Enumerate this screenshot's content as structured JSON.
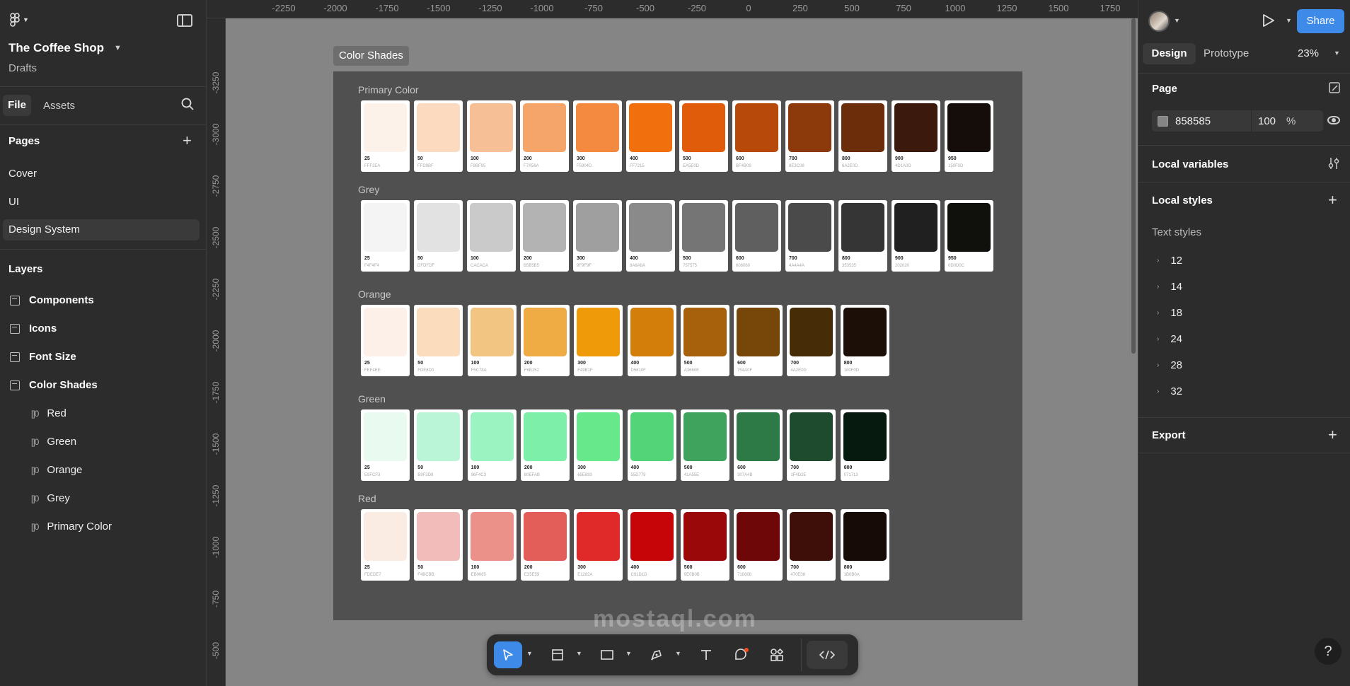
{
  "project": {
    "title": "The Coffee Shop",
    "location": "Drafts"
  },
  "left": {
    "tabs": {
      "file": "File",
      "assets": "Assets"
    },
    "pages_heading": "Pages",
    "pages": [
      "Cover",
      "UI",
      "Design System"
    ],
    "layers_heading": "Layers",
    "layers": [
      "Components",
      "Icons",
      "Font Size",
      "Color Shades"
    ],
    "sublayers": [
      "Red",
      "Green",
      "Orange",
      "Grey",
      "Primary Color"
    ]
  },
  "ruler_top": [
    "-2250",
    "-2000",
    "-1750",
    "-1500",
    "-1250",
    "-1000",
    "-750",
    "-500",
    "-250",
    "0",
    "250",
    "500",
    "750",
    "1000",
    "1250",
    "1500",
    "1750"
  ],
  "ruler_left": [
    "-3250",
    "-3000",
    "-2750",
    "-2500",
    "-2250",
    "-2000",
    "-1750",
    "-1500",
    "-1250",
    "-1000",
    "-750",
    "-500"
  ],
  "canvas": {
    "frame_label": "Color Shades",
    "groups": [
      {
        "title": "Primary Color",
        "cards": [
          {
            "name": "25",
            "hex": "FFF2EA",
            "color": "#fcf2ea"
          },
          {
            "name": "50",
            "hex": "FFD9BF",
            "color": "#fbdabf"
          },
          {
            "name": "100",
            "hex": "F9BF95",
            "color": "#f7bf95"
          },
          {
            "name": "200",
            "hex": "F7A56A",
            "color": "#f5a46a"
          },
          {
            "name": "300",
            "hex": "F5904D",
            "color": "#f38a40"
          },
          {
            "name": "400",
            "hex": "FF7215",
            "color": "#f26f0d"
          },
          {
            "name": "500",
            "hex": "EA5E0D",
            "color": "#e05b0a"
          },
          {
            "name": "600",
            "hex": "BF4B09",
            "color": "#b74a0a"
          },
          {
            "name": "700",
            "hex": "8E3C08",
            "color": "#8c3a0b"
          },
          {
            "name": "800",
            "hex": "6A2E0D",
            "color": "#6b2d0a"
          },
          {
            "name": "900",
            "hex": "4D1A0D",
            "color": "#3b1a0d"
          },
          {
            "name": "950",
            "hex": "150F0D",
            "color": "#150d0a"
          }
        ]
      },
      {
        "title": "Grey",
        "cards": [
          {
            "name": "25",
            "hex": "F4F4F4",
            "color": "#f4f4f4"
          },
          {
            "name": "50",
            "hex": "DFDFDF",
            "color": "#e2e2e2"
          },
          {
            "name": "100",
            "hex": "CACACA",
            "color": "#cacaca"
          },
          {
            "name": "200",
            "hex": "B5B5B5",
            "color": "#b3b3b3"
          },
          {
            "name": "300",
            "hex": "9F9F9F",
            "color": "#9f9f9f"
          },
          {
            "name": "400",
            "hex": "8A8A8A",
            "color": "#8a8a8a"
          },
          {
            "name": "500",
            "hex": "757575",
            "color": "#757575"
          },
          {
            "name": "600",
            "hex": "606060",
            "color": "#5f5f5f"
          },
          {
            "name": "700",
            "hex": "4A4A4A",
            "color": "#4a4a4a"
          },
          {
            "name": "800",
            "hex": "353535",
            "color": "#353535"
          },
          {
            "name": "900",
            "hex": "202020",
            "color": "#202020"
          },
          {
            "name": "950",
            "hex": "0D0D0C",
            "color": "#10110d"
          }
        ]
      },
      {
        "title": "Orange",
        "cards": [
          {
            "name": "25",
            "hex": "FEF4EE",
            "color": "#fdf0e8"
          },
          {
            "name": "50",
            "hex": "FDE8D0",
            "color": "#fbdcbd"
          },
          {
            "name": "100",
            "hex": "F5C78A",
            "color": "#f2c583"
          },
          {
            "name": "200",
            "hex": "F6B152",
            "color": "#efab44"
          },
          {
            "name": "300",
            "hex": "F49B1F",
            "color": "#ef9a08"
          },
          {
            "name": "400",
            "hex": "D5810F",
            "color": "#d37d0b"
          },
          {
            "name": "500",
            "hex": "A3660E",
            "color": "#a7600c"
          },
          {
            "name": "600",
            "hex": "754A0F",
            "color": "#774709"
          },
          {
            "name": "700",
            "hex": "4A2E0D",
            "color": "#472c08"
          },
          {
            "name": "800",
            "hex": "180F0D",
            "color": "#1c0f07"
          }
        ]
      },
      {
        "title": "Green",
        "cards": [
          {
            "name": "25",
            "hex": "E9FCF3",
            "color": "#e9fbf1"
          },
          {
            "name": "50",
            "hex": "B9F3D8",
            "color": "#b9f5d6"
          },
          {
            "name": "100",
            "hex": "96F4C3",
            "color": "#9bf3c1"
          },
          {
            "name": "200",
            "hex": "80EFAB",
            "color": "#7eefa8"
          },
          {
            "name": "300",
            "hex": "65E893",
            "color": "#67e88b"
          },
          {
            "name": "400",
            "hex": "55D779",
            "color": "#54d479"
          },
          {
            "name": "500",
            "hex": "41A55E",
            "color": "#40a35d"
          },
          {
            "name": "600",
            "hex": "307A4B",
            "color": "#2e7a46"
          },
          {
            "name": "700",
            "hex": "1F4D2E",
            "color": "#1e4a2d"
          },
          {
            "name": "800",
            "hex": "071713",
            "color": "#071a10"
          }
        ]
      },
      {
        "title": "Red",
        "cards": [
          {
            "name": "25",
            "hex": "FDEDE7",
            "color": "#fbece3"
          },
          {
            "name": "50",
            "hex": "F4BCBB",
            "color": "#f2bcba"
          },
          {
            "name": "100",
            "hex": "EB9085",
            "color": "#ec908a"
          },
          {
            "name": "200",
            "hex": "E35E59",
            "color": "#e35e59"
          },
          {
            "name": "300",
            "hex": "E1282A",
            "color": "#e02a2a"
          },
          {
            "name": "400",
            "hex": "C91D1D",
            "color": "#c50508"
          },
          {
            "name": "500",
            "hex": "9E0B0B",
            "color": "#9a080a"
          },
          {
            "name": "600",
            "hex": "710808",
            "color": "#6d0708"
          },
          {
            "name": "700",
            "hex": "470E08",
            "color": "#3e0e08"
          },
          {
            "name": "800",
            "hex": "1B0B0A",
            "color": "#170b07"
          }
        ]
      }
    ]
  },
  "right": {
    "share": "Share",
    "tabs": {
      "design": "Design",
      "prototype": "Prototype"
    },
    "zoom": "23%",
    "page_heading": "Page",
    "page_color_hex": "858585",
    "page_color": "#858585",
    "page_opacity": "100",
    "percent": "%",
    "local_variables": "Local variables",
    "local_styles": "Local styles",
    "text_styles_heading": "Text styles",
    "text_styles": [
      "12",
      "14",
      "18",
      "24",
      "28",
      "32"
    ],
    "export": "Export",
    "help": "?"
  },
  "watermark": "mostaql.com",
  "colors": {
    "accent": "#3d8ae8",
    "panel": "#2c2c2c",
    "canvas": "#858585",
    "frame": "#505050"
  }
}
